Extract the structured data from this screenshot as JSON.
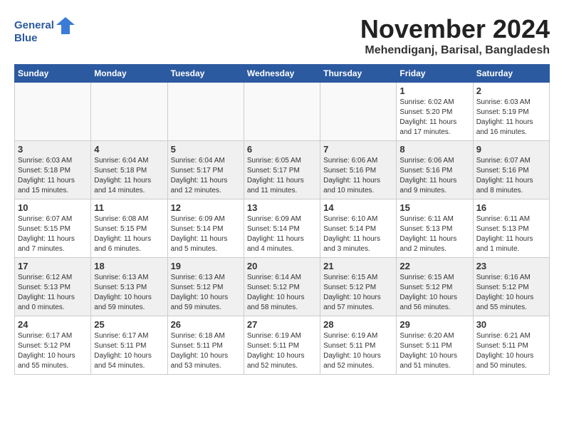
{
  "logo": {
    "line1": "General",
    "line2": "Blue"
  },
  "title": "November 2024",
  "location": "Mehendiganj, Barisal, Bangladesh",
  "days_of_week": [
    "Sunday",
    "Monday",
    "Tuesday",
    "Wednesday",
    "Thursday",
    "Friday",
    "Saturday"
  ],
  "weeks": [
    [
      {
        "day": "",
        "content": ""
      },
      {
        "day": "",
        "content": ""
      },
      {
        "day": "",
        "content": ""
      },
      {
        "day": "",
        "content": ""
      },
      {
        "day": "",
        "content": ""
      },
      {
        "day": "1",
        "content": "Sunrise: 6:02 AM\nSunset: 5:20 PM\nDaylight: 11 hours and 17 minutes."
      },
      {
        "day": "2",
        "content": "Sunrise: 6:03 AM\nSunset: 5:19 PM\nDaylight: 11 hours and 16 minutes."
      }
    ],
    [
      {
        "day": "3",
        "content": "Sunrise: 6:03 AM\nSunset: 5:18 PM\nDaylight: 11 hours and 15 minutes."
      },
      {
        "day": "4",
        "content": "Sunrise: 6:04 AM\nSunset: 5:18 PM\nDaylight: 11 hours and 14 minutes."
      },
      {
        "day": "5",
        "content": "Sunrise: 6:04 AM\nSunset: 5:17 PM\nDaylight: 11 hours and 12 minutes."
      },
      {
        "day": "6",
        "content": "Sunrise: 6:05 AM\nSunset: 5:17 PM\nDaylight: 11 hours and 11 minutes."
      },
      {
        "day": "7",
        "content": "Sunrise: 6:06 AM\nSunset: 5:16 PM\nDaylight: 11 hours and 10 minutes."
      },
      {
        "day": "8",
        "content": "Sunrise: 6:06 AM\nSunset: 5:16 PM\nDaylight: 11 hours and 9 minutes."
      },
      {
        "day": "9",
        "content": "Sunrise: 6:07 AM\nSunset: 5:16 PM\nDaylight: 11 hours and 8 minutes."
      }
    ],
    [
      {
        "day": "10",
        "content": "Sunrise: 6:07 AM\nSunset: 5:15 PM\nDaylight: 11 hours and 7 minutes."
      },
      {
        "day": "11",
        "content": "Sunrise: 6:08 AM\nSunset: 5:15 PM\nDaylight: 11 hours and 6 minutes."
      },
      {
        "day": "12",
        "content": "Sunrise: 6:09 AM\nSunset: 5:14 PM\nDaylight: 11 hours and 5 minutes."
      },
      {
        "day": "13",
        "content": "Sunrise: 6:09 AM\nSunset: 5:14 PM\nDaylight: 11 hours and 4 minutes."
      },
      {
        "day": "14",
        "content": "Sunrise: 6:10 AM\nSunset: 5:14 PM\nDaylight: 11 hours and 3 minutes."
      },
      {
        "day": "15",
        "content": "Sunrise: 6:11 AM\nSunset: 5:13 PM\nDaylight: 11 hours and 2 minutes."
      },
      {
        "day": "16",
        "content": "Sunrise: 6:11 AM\nSunset: 5:13 PM\nDaylight: 11 hours and 1 minute."
      }
    ],
    [
      {
        "day": "17",
        "content": "Sunrise: 6:12 AM\nSunset: 5:13 PM\nDaylight: 11 hours and 0 minutes."
      },
      {
        "day": "18",
        "content": "Sunrise: 6:13 AM\nSunset: 5:13 PM\nDaylight: 10 hours and 59 minutes."
      },
      {
        "day": "19",
        "content": "Sunrise: 6:13 AM\nSunset: 5:12 PM\nDaylight: 10 hours and 59 minutes."
      },
      {
        "day": "20",
        "content": "Sunrise: 6:14 AM\nSunset: 5:12 PM\nDaylight: 10 hours and 58 minutes."
      },
      {
        "day": "21",
        "content": "Sunrise: 6:15 AM\nSunset: 5:12 PM\nDaylight: 10 hours and 57 minutes."
      },
      {
        "day": "22",
        "content": "Sunrise: 6:15 AM\nSunset: 5:12 PM\nDaylight: 10 hours and 56 minutes."
      },
      {
        "day": "23",
        "content": "Sunrise: 6:16 AM\nSunset: 5:12 PM\nDaylight: 10 hours and 55 minutes."
      }
    ],
    [
      {
        "day": "24",
        "content": "Sunrise: 6:17 AM\nSunset: 5:12 PM\nDaylight: 10 hours and 55 minutes."
      },
      {
        "day": "25",
        "content": "Sunrise: 6:17 AM\nSunset: 5:11 PM\nDaylight: 10 hours and 54 minutes."
      },
      {
        "day": "26",
        "content": "Sunrise: 6:18 AM\nSunset: 5:11 PM\nDaylight: 10 hours and 53 minutes."
      },
      {
        "day": "27",
        "content": "Sunrise: 6:19 AM\nSunset: 5:11 PM\nDaylight: 10 hours and 52 minutes."
      },
      {
        "day": "28",
        "content": "Sunrise: 6:19 AM\nSunset: 5:11 PM\nDaylight: 10 hours and 52 minutes."
      },
      {
        "day": "29",
        "content": "Sunrise: 6:20 AM\nSunset: 5:11 PM\nDaylight: 10 hours and 51 minutes."
      },
      {
        "day": "30",
        "content": "Sunrise: 6:21 AM\nSunset: 5:11 PM\nDaylight: 10 hours and 50 minutes."
      }
    ]
  ]
}
